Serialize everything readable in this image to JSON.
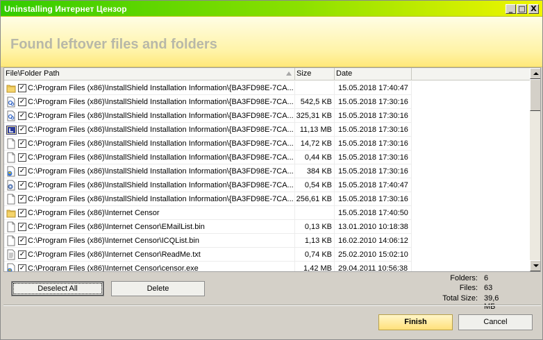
{
  "window": {
    "title": "Uninstalling Интернет Цензор",
    "minimize_label": "_",
    "maximize_label": "□",
    "close_label": "X"
  },
  "header": {
    "heading": "Found leftover files and folders"
  },
  "columns": {
    "path": "File\\Folder Path",
    "size": "Size",
    "date": "Date"
  },
  "rows": [
    {
      "icon": "folder-icon",
      "checked": true,
      "path": "C:\\Program Files (x86)\\InstallShield Installation Information\\{BA3FD98E-7CA...",
      "size": "",
      "date": "15.05.2018 17:40:47"
    },
    {
      "icon": "dll-file-icon",
      "checked": true,
      "path": "C:\\Program Files (x86)\\InstallShield Installation Information\\{BA3FD98E-7CA...",
      "size": "542,5 KB",
      "date": "15.05.2018 17:30:16"
    },
    {
      "icon": "dll-file-icon",
      "checked": true,
      "path": "C:\\Program Files (x86)\\InstallShield Installation Information\\{BA3FD98E-7CA...",
      "size": "325,31 KB",
      "date": "15.05.2018 17:30:16"
    },
    {
      "icon": "installer-file-icon",
      "checked": true,
      "path": "C:\\Program Files (x86)\\InstallShield Installation Information\\{BA3FD98E-7CA...",
      "size": "11,13 MB",
      "date": "15.05.2018 17:30:16"
    },
    {
      "icon": "blank-file-icon",
      "checked": true,
      "path": "C:\\Program Files (x86)\\InstallShield Installation Information\\{BA3FD98E-7CA...",
      "size": "14,72 KB",
      "date": "15.05.2018 17:30:16"
    },
    {
      "icon": "blank-file-icon",
      "checked": true,
      "path": "C:\\Program Files (x86)\\InstallShield Installation Information\\{BA3FD98E-7CA...",
      "size": "0,44 KB",
      "date": "15.05.2018 17:30:16"
    },
    {
      "icon": "exe-file-icon",
      "checked": true,
      "path": "C:\\Program Files (x86)\\InstallShield Installation Information\\{BA3FD98E-7CA...",
      "size": "384 KB",
      "date": "15.05.2018 17:30:16"
    },
    {
      "icon": "config-file-icon",
      "checked": true,
      "path": "C:\\Program Files (x86)\\InstallShield Installation Information\\{BA3FD98E-7CA...",
      "size": "0,54 KB",
      "date": "15.05.2018 17:40:47"
    },
    {
      "icon": "blank-file-icon",
      "checked": true,
      "path": "C:\\Program Files (x86)\\InstallShield Installation Information\\{BA3FD98E-7CA...",
      "size": "256,61 KB",
      "date": "15.05.2018 17:30:16"
    },
    {
      "icon": "folder-icon",
      "checked": true,
      "path": "C:\\Program Files (x86)\\Internet Censor",
      "size": "",
      "date": "15.05.2018 17:40:50"
    },
    {
      "icon": "blank-file-icon",
      "checked": true,
      "path": "C:\\Program Files (x86)\\Internet Censor\\EMailList.bin",
      "size": "0,13 KB",
      "date": "13.01.2010 10:18:38"
    },
    {
      "icon": "blank-file-icon",
      "checked": true,
      "path": "C:\\Program Files (x86)\\Internet Censor\\ICQList.bin",
      "size": "1,13 KB",
      "date": "16.02.2010 14:06:12"
    },
    {
      "icon": "text-file-icon",
      "checked": true,
      "path": "C:\\Program Files (x86)\\Internet Censor\\ReadMe.txt",
      "size": "0,74 KB",
      "date": "25.02.2010 15:02:10"
    },
    {
      "icon": "exe-file-icon",
      "checked": true,
      "path": "C:\\Program Files (x86)\\Internet Censor\\censor.exe",
      "size": "1,42 MB",
      "date": "29.04.2011 10:56:38"
    }
  ],
  "buttons": {
    "deselect_all": "Deselect All",
    "delete": "Delete",
    "finish": "Finish",
    "cancel": "Cancel"
  },
  "stats": {
    "folders_label": "Folders:",
    "folders_value": "6",
    "files_label": "Files:",
    "files_value": "63",
    "total_label": "Total Size:",
    "total_value": "39,6 МБ"
  },
  "colors": {
    "title_gradient_start": "#33cc00",
    "title_gradient_end": "#f2f600",
    "header_bg": "#fff3a6",
    "heading_text": "#b8b8a8",
    "finish_bg": "#ffe07a"
  }
}
